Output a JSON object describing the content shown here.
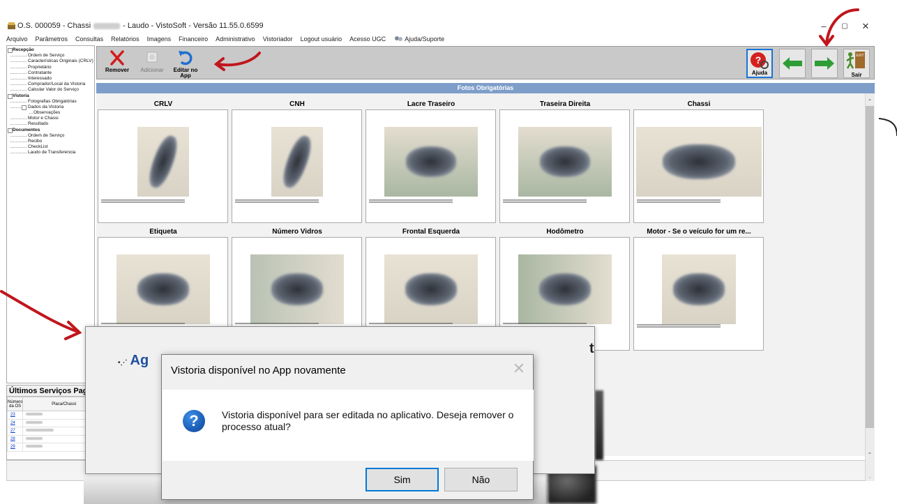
{
  "window": {
    "title_prefix": "O.S. 000059 - Chassi",
    "title_suffix": "- Laudo  - VistoSoft - Versão 11.55.0.6599",
    "minimize": "–",
    "restore": "▢",
    "close": "✕"
  },
  "menu": [
    "Arquivo",
    "Parâmetros",
    "Consultas",
    "Relatórios",
    "Imagens",
    "Financeiro",
    "Administrativo",
    "Vistoriador",
    "Logout usuário",
    "Acesso UGC",
    "Ajuda/Suporte"
  ],
  "tree": [
    {
      "label": "Recepção",
      "level": 0
    },
    {
      "label": "Ordem de Serviço",
      "level": 1
    },
    {
      "label": "Características Originais (CRLV)",
      "level": 1
    },
    {
      "label": "Proprietário",
      "level": 1
    },
    {
      "label": "Contratante",
      "level": 1
    },
    {
      "label": "Interessado",
      "level": 1
    },
    {
      "label": "Comprador/Local da Vistoria",
      "level": 1
    },
    {
      "label": "Calcular Valor do Serviço",
      "level": 1
    },
    {
      "label": "Vistoria",
      "level": 0
    },
    {
      "label": "Fotografias Obrigatórias",
      "level": 1
    },
    {
      "label": "Dados da Vistoria",
      "level": 1
    },
    {
      "label": "Observações",
      "level": 2
    },
    {
      "label": "Motor e Chassi",
      "level": 1
    },
    {
      "label": "Resultado",
      "level": 1
    },
    {
      "label": "Documentos",
      "level": 0
    },
    {
      "label": "Ordem de Serviço",
      "level": 1
    },
    {
      "label": "Recibo",
      "level": 1
    },
    {
      "label": "CheckList",
      "level": 1
    },
    {
      "label": "Laudo de Transferencia",
      "level": 1
    }
  ],
  "services": {
    "title": "Últimos Serviços Pagos",
    "col_number": "Número da OS",
    "col_plate": "Placa/Chassi",
    "rows": [
      "23",
      "24",
      "27",
      "28",
      "29"
    ]
  },
  "toolbar": {
    "remove": "Remover",
    "add": "Adicionar",
    "edit_app": "Editar no App",
    "help": "Ajuda",
    "exit": "Sair"
  },
  "section_title": "Fotos Obrigatórias",
  "photos": [
    "CRLV",
    "CNH",
    "Lacre Traseiro",
    "Traseira Direita",
    "Chassi",
    "Etiqueta",
    "Número Vidros",
    "Frontal Esquerda",
    "Hodômetro",
    "Motor - Se o veículo for um re..."
  ],
  "bg_dialog": {
    "logo": "Ag",
    "right_text": "t"
  },
  "modal": {
    "title": "Vistoria disponível no App novamente",
    "message": "Vistoria disponível para ser editada no aplicativo. Deseja remover o processo atual?",
    "yes": "Sim",
    "no": "Não",
    "close": "✕"
  },
  "colors": {
    "section_bar": "#7e9ec9",
    "toolbar_bg": "#c9c9c9",
    "annotation": "#c0161c",
    "primary_border": "#0078d7"
  }
}
